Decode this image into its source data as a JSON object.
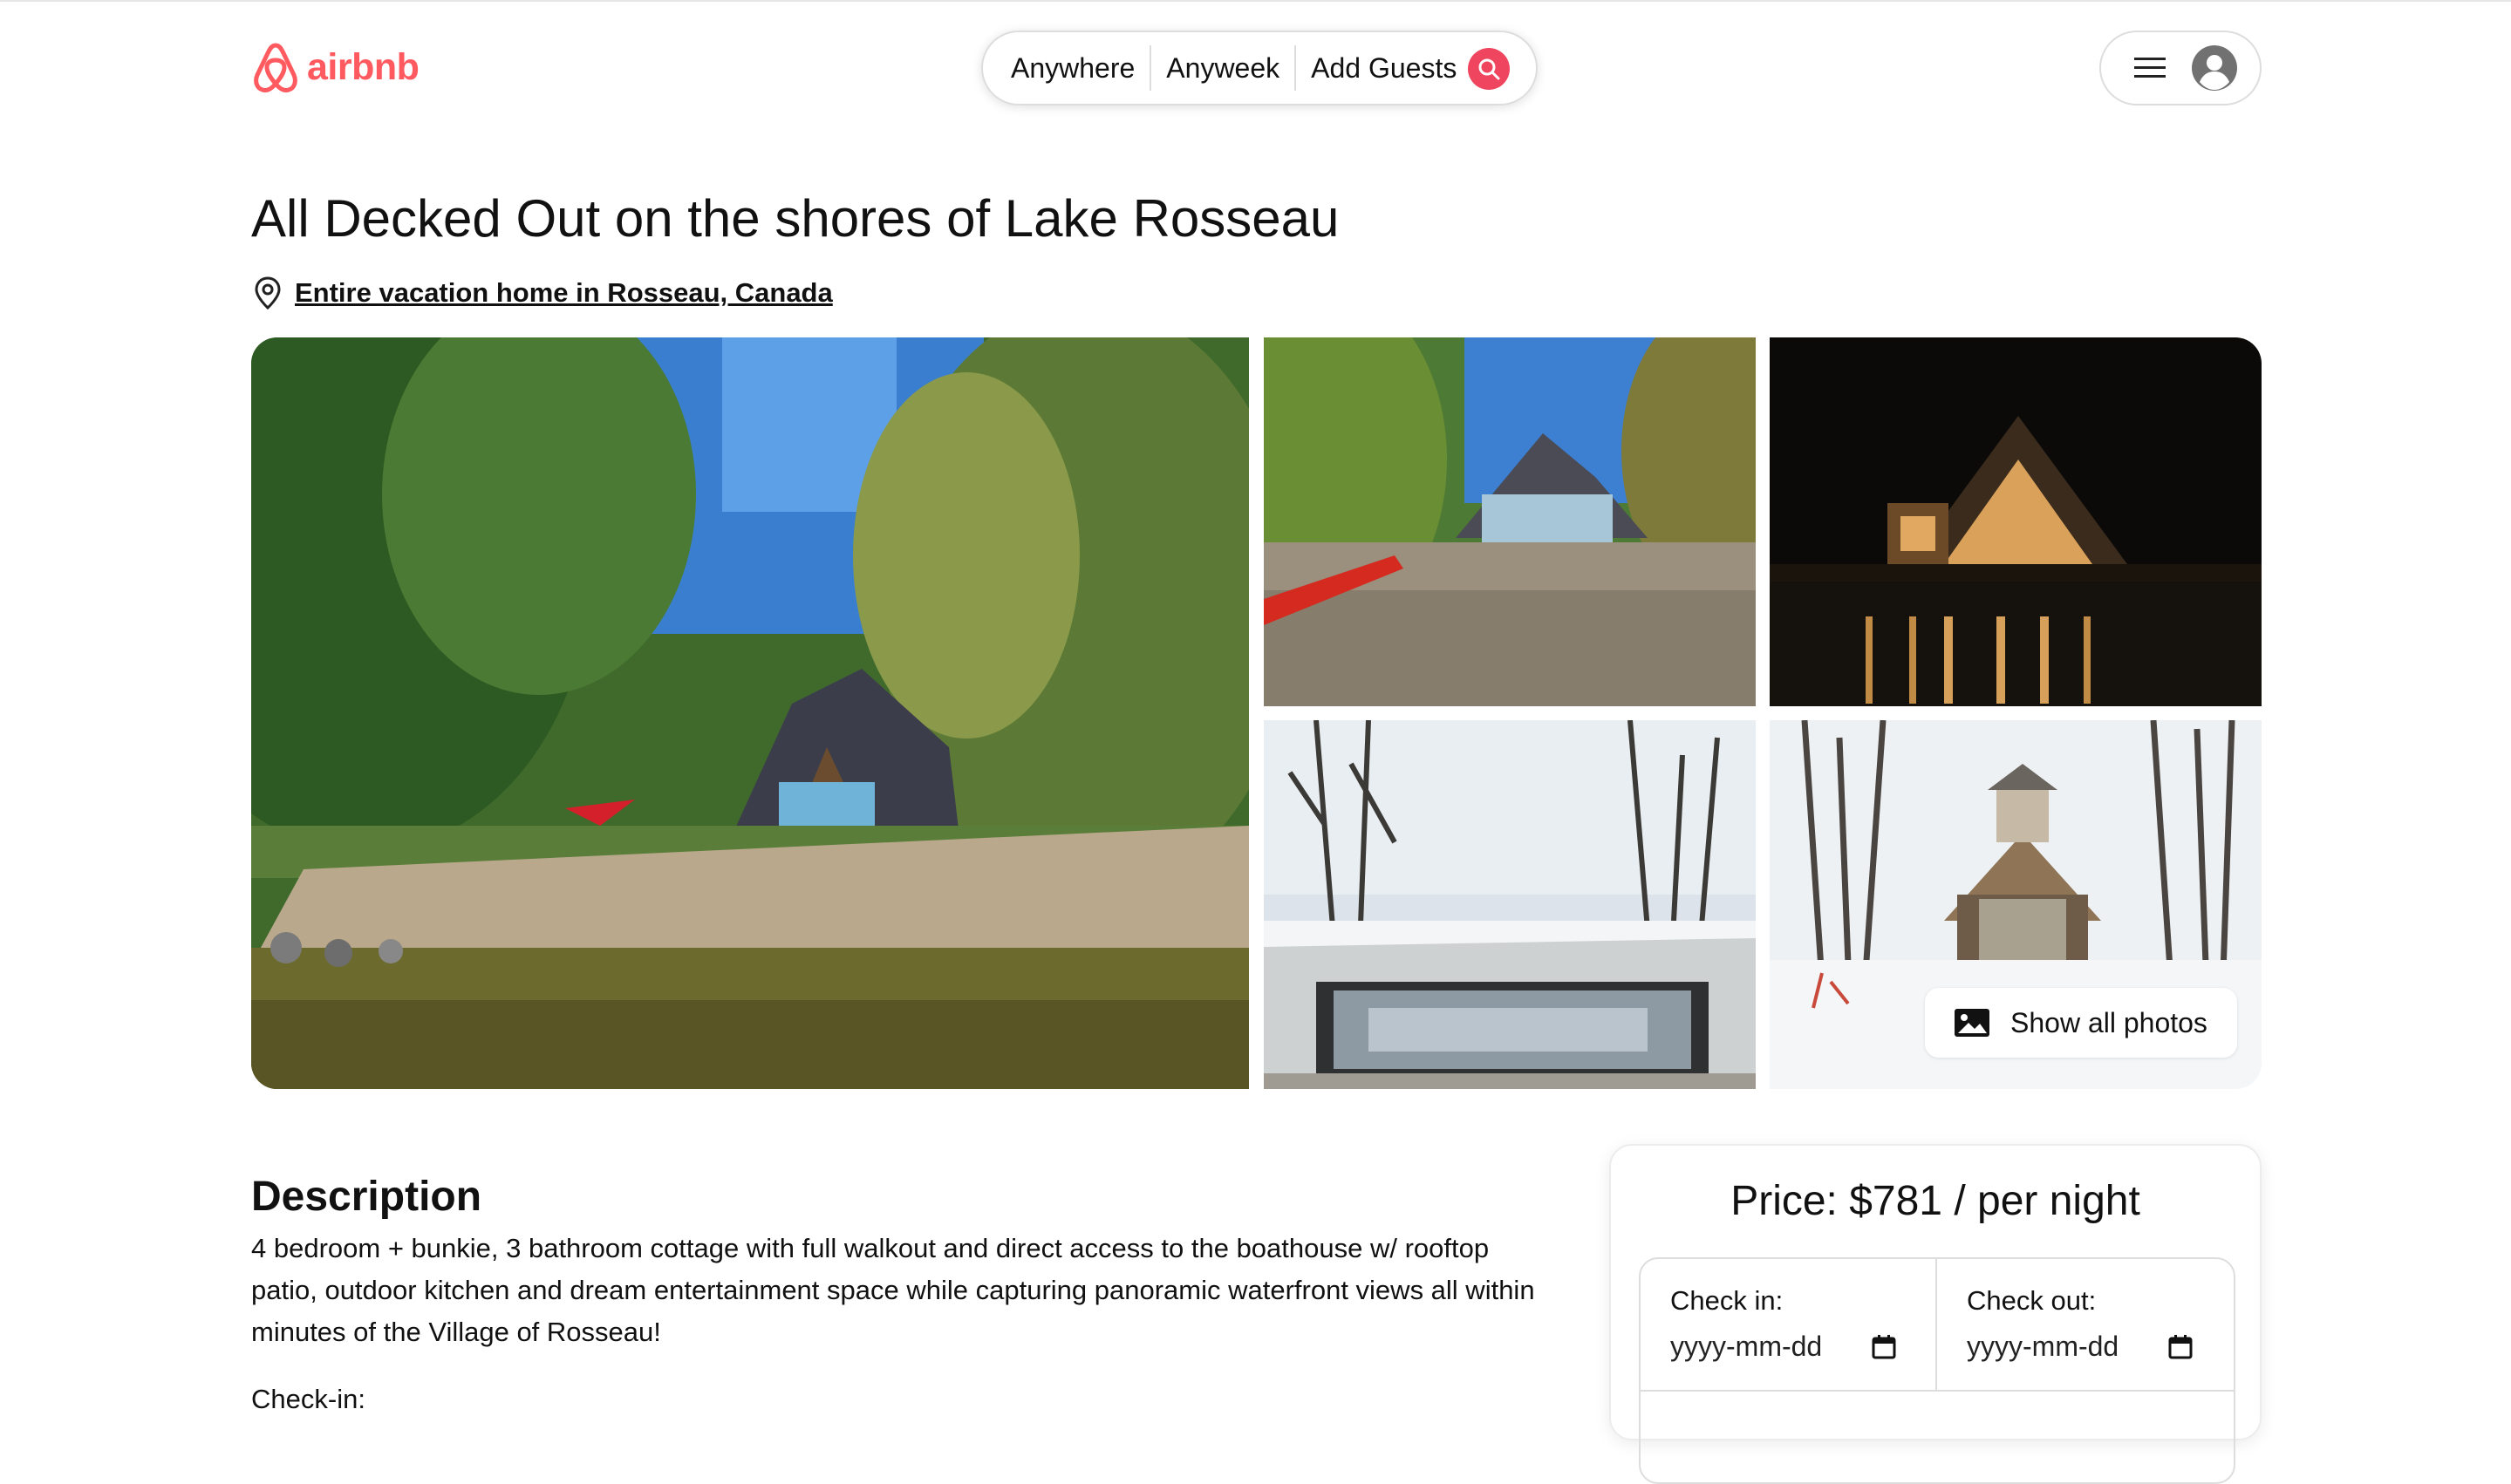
{
  "header": {
    "logo_text": "airbnb",
    "brand_color": "#ff5a5f",
    "search": {
      "anywhere": "Anywhere",
      "anyweek": "Anyweek",
      "add_guests": "Add Guests"
    }
  },
  "listing": {
    "title": "All Decked Out on the shores of Lake Rosseau",
    "location": "Entire vacation home in Rosseau, Canada"
  },
  "gallery": {
    "show_all_label": "Show all photos"
  },
  "description": {
    "heading": "Description",
    "body": "4 bedroom + bunkie, 3 bathroom cottage with full walkout and direct access to the boathouse w/ rooftop patio, outdoor kitchen and dream entertainment space while capturing panoramic waterfront views all within minutes of the Village of Rosseau!",
    "checkin_label": "Check-in:"
  },
  "booking": {
    "price": "Price: $781 / per night",
    "check_in_label": "Check in:",
    "check_out_label": "Check out:",
    "check_in_value": "yyyy-mm-dd",
    "check_out_value": "yyyy-mm-dd"
  }
}
